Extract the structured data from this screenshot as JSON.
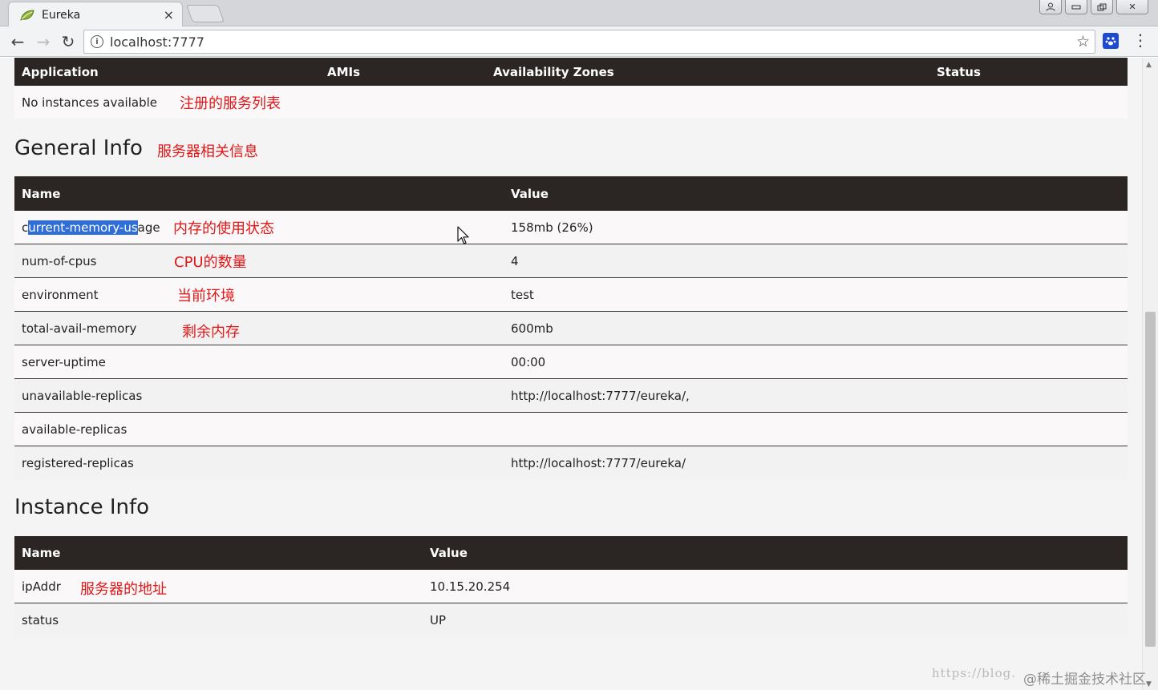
{
  "browser": {
    "tab_title": "Eureka",
    "tab_close": "×",
    "url": "localhost:7777",
    "info": "i",
    "star": "☆",
    "menu": "⋮",
    "back": "←",
    "forward": "→",
    "reload": "↻",
    "window_user": "👤",
    "window_min": "▭",
    "window_max": "⧉",
    "window_close": "✕"
  },
  "instances_table": {
    "headers": {
      "application": "Application",
      "amis": "AMIs",
      "zones": "Availability Zones",
      "status": "Status"
    },
    "empty_text": "No instances available",
    "note": "注册的服务列表"
  },
  "general_info": {
    "title": "General Info",
    "note": "服务器相关信息",
    "headers": {
      "name": "Name",
      "value": "Value"
    },
    "rows": [
      {
        "name_pre": "c",
        "name_sel": "urrent-memory-us",
        "name_post": "age",
        "value": "158mb (26%)",
        "note": "内存的使用状态"
      },
      {
        "name": "num-of-cpus",
        "value": "4",
        "note": "CPU的数量"
      },
      {
        "name": "environment",
        "value": "test",
        "note": "当前环境"
      },
      {
        "name": "total-avail-memory",
        "value": "600mb",
        "note": "剩余内存"
      },
      {
        "name": "server-uptime",
        "value": "00:00"
      },
      {
        "name": "unavailable-replicas",
        "value": "http://localhost:7777/eureka/,"
      },
      {
        "name": "available-replicas",
        "value": ""
      },
      {
        "name": "registered-replicas",
        "value": "http://localhost:7777/eureka/"
      }
    ]
  },
  "instance_info": {
    "title": "Instance Info",
    "headers": {
      "name": "Name",
      "value": "Value"
    },
    "rows": [
      {
        "name": "ipAddr",
        "value": "10.15.20.254",
        "note": "服务器的地址"
      },
      {
        "name": "status",
        "value": "UP"
      }
    ]
  },
  "watermark": {
    "url": "https://blog.",
    "tag": "@稀土掘金技术社区"
  },
  "colors": {
    "header_bg": "#2b2523",
    "note_red": "#e01818",
    "selection": "#2f6ed8"
  },
  "icons": {
    "tab_favicon": "leaf-icon",
    "extension": "paw-icon",
    "cursor": "mouse-pointer-icon"
  }
}
